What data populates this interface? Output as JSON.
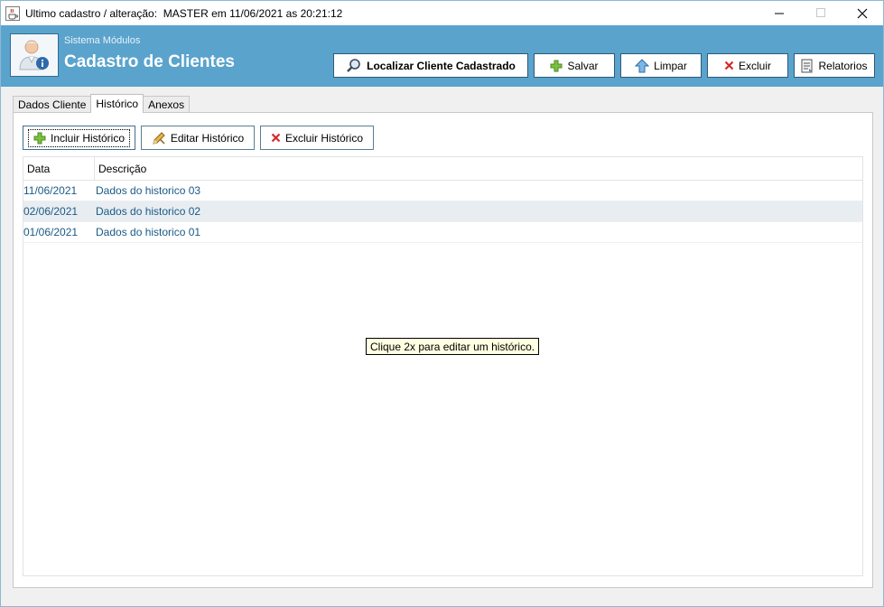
{
  "window": {
    "title": "Ultimo cadastro / alteração:  MASTER em 11/06/2021 as 20:21:12",
    "icon": "java-cup-icon",
    "controls": [
      "minimize",
      "maximize",
      "close"
    ]
  },
  "header": {
    "subtitle": "Sistema Módulos",
    "title": "Cadastro de Clientes",
    "buttons": [
      {
        "label": "Localizar Cliente Cadastrado",
        "icon": "magnifier-icon"
      },
      {
        "label": "Salvar",
        "icon": "plus-icon"
      },
      {
        "label": "Limpar",
        "icon": "arrow-up-icon"
      },
      {
        "label": "Excluir",
        "icon": "x-icon"
      },
      {
        "label": "Relatorios",
        "icon": "report-icon"
      }
    ]
  },
  "tabs": [
    {
      "label": "Dados Cliente",
      "active": false
    },
    {
      "label": "Histórico",
      "active": true
    },
    {
      "label": "Anexos",
      "active": false
    }
  ],
  "actions": [
    {
      "label": "Incluir Histórico",
      "icon": "plus-icon"
    },
    {
      "label": "Editar Histórico",
      "icon": "edit-icon"
    },
    {
      "label": "Excluir Histórico",
      "icon": "x-icon"
    }
  ],
  "table": {
    "columns": [
      "Data",
      "Descrição"
    ],
    "rows": [
      {
        "date": "11/06/2021",
        "description": "Dados do historico 03"
      },
      {
        "date": "02/06/2021",
        "description": "Dados do historico 02"
      },
      {
        "date": "01/06/2021",
        "description": "Dados do historico 01"
      }
    ]
  },
  "tooltip": "Clique 2x para editar um histórico.",
  "colors": {
    "header_bg": "#5aa3cc",
    "link_text": "#1a5a86",
    "row_highlight": "#e8edf1"
  }
}
